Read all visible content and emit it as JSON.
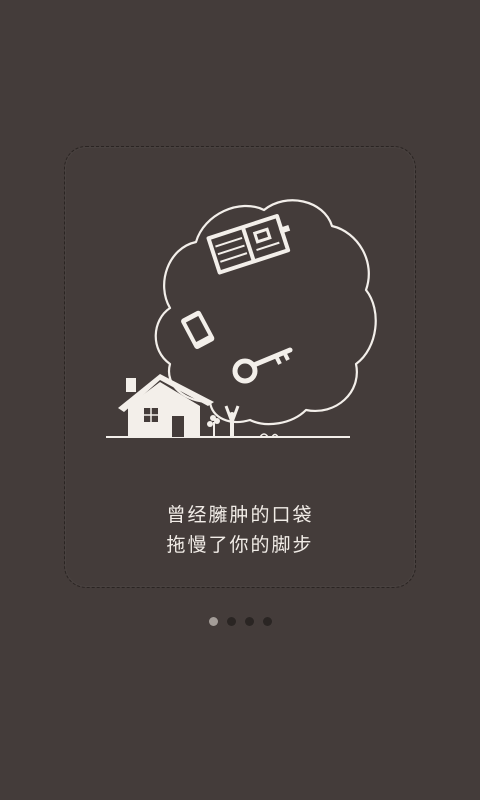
{
  "slide": {
    "caption_line1": "曾经臃肿的口袋",
    "caption_line2": "拖慢了你的脚步"
  },
  "pager": {
    "total": 4,
    "active_index": 0
  },
  "illustration": {
    "icons": [
      "cloud-icon",
      "wallet-icon",
      "phone-icon",
      "key-icon",
      "house-icon",
      "tree-icon",
      "person-icon"
    ]
  },
  "colors": {
    "background": "#443c3a",
    "line": "#f3efea",
    "dot_active": "#a49d98",
    "dot_inactive": "#2a2523"
  }
}
